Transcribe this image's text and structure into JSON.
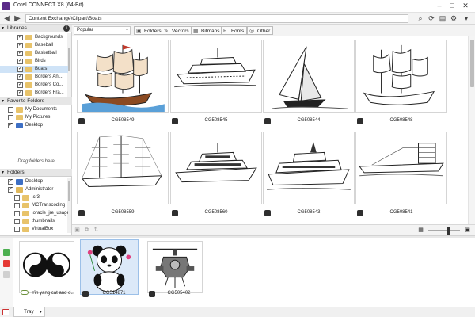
{
  "window": {
    "title": "Corel CONNECT X8 (64-Bit)",
    "controls": [
      "–",
      "□",
      "✕"
    ]
  },
  "addressbar": {
    "back": "◀",
    "forward": "▶",
    "path": "Content Exchange\\Clipart\\Boats"
  },
  "sidebar": {
    "libraries": {
      "header": "Libraries",
      "info": "i",
      "items": [
        {
          "label": "Backgrounds",
          "checked": true
        },
        {
          "label": "Baseball",
          "checked": true
        },
        {
          "label": "Basketball",
          "checked": true
        },
        {
          "label": "Birds",
          "checked": true
        },
        {
          "label": "Boats",
          "checked": true,
          "selected": true
        },
        {
          "label": "Borders Ani...",
          "checked": true
        },
        {
          "label": "Borders Co...",
          "checked": true
        },
        {
          "label": "Borders Fra...",
          "checked": true
        }
      ]
    },
    "favorites": {
      "header": "Favorite Folders",
      "items": [
        {
          "label": "My Documents",
          "checked": false
        },
        {
          "label": "My Pictures",
          "checked": false
        },
        {
          "label": "Desktop",
          "checked": true
        }
      ],
      "hint": "Drag folders here"
    },
    "folders": {
      "header": "Folders",
      "items": [
        {
          "label": "Desktop",
          "checked": true,
          "color": "#3d6fc4"
        },
        {
          "label": "Administrator",
          "checked": true,
          "color": "#e0b85a"
        },
        {
          "label": ".cr3",
          "checked": false,
          "color": "#e8c36a"
        },
        {
          "label": "MCTranscoding",
          "checked": false,
          "color": "#e8c36a"
        },
        {
          "label": ".oracle_jre_usage",
          "checked": false,
          "color": "#e8c36a"
        },
        {
          "label": "thumbnails",
          "checked": false,
          "color": "#e8c36a"
        },
        {
          "label": "VirtualBox",
          "checked": false,
          "color": "#e8c36a"
        }
      ]
    }
  },
  "filterbar": {
    "sort_value": "Popular",
    "buttons": [
      {
        "label": "Folders",
        "icon": "▣"
      },
      {
        "label": "Vectors",
        "icon": "✎"
      },
      {
        "label": "Bitmaps",
        "icon": "▦"
      },
      {
        "label": "Fonts",
        "icon": "F"
      },
      {
        "label": "Other",
        "icon": "◎"
      }
    ]
  },
  "grid": {
    "items": [
      {
        "id": "CG508549",
        "art": "galleon-color"
      },
      {
        "id": "CG508545",
        "art": "yacht"
      },
      {
        "id": "CG508544",
        "art": "sailboat"
      },
      {
        "id": "CG508548",
        "art": "galleon-outline"
      },
      {
        "id": "CG508559",
        "art": "clipper"
      },
      {
        "id": "CG508560",
        "art": "motor-yacht"
      },
      {
        "id": "CG508543",
        "art": "ferry"
      },
      {
        "id": "CG508541",
        "art": "cargo-ship"
      }
    ]
  },
  "tray": {
    "items": [
      {
        "label": "Yin yang cat and d...",
        "art": "yinyang"
      },
      {
        "label": "CG514871",
        "art": "panda",
        "selected": true
      },
      {
        "label": "CG505402",
        "art": "helicopter"
      }
    ],
    "tab_label": "Tray"
  },
  "colors": {
    "accent": "#5b2b89",
    "selection": "#cfe3f7",
    "panel_header": "#e6e6e6"
  }
}
